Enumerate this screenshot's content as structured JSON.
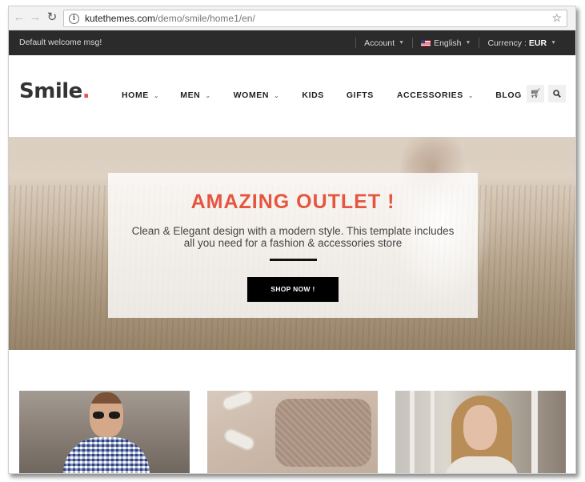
{
  "browser": {
    "url_domain": "kutethemes.com",
    "url_path": "/demo/smile/home1/en/",
    "back_icon": "arrow-left-icon",
    "forward_icon": "arrow-right-icon",
    "reload_icon": "reload-icon",
    "info_icon": "info-icon",
    "bookmark_icon": "star-icon"
  },
  "topbar": {
    "welcome": "Default welcome msg!",
    "account": "Account",
    "language": "English",
    "currency_label": "Currency :",
    "currency_value": "EUR"
  },
  "header": {
    "logo_text": "Smile",
    "logo_dot": ".",
    "menu": [
      {
        "label": "HOME",
        "has_dropdown": true
      },
      {
        "label": "MEN",
        "has_dropdown": true
      },
      {
        "label": "WOMEN",
        "has_dropdown": true
      },
      {
        "label": "KIDS",
        "has_dropdown": false
      },
      {
        "label": "GIFTS",
        "has_dropdown": false
      },
      {
        "label": "ACCESSORIES",
        "has_dropdown": true
      },
      {
        "label": "BLOG",
        "has_dropdown": false
      }
    ],
    "cart_icon": "cart-icon",
    "search_icon": "search-icon"
  },
  "hero": {
    "title": "AMAZING OUTLET !",
    "subtitle_line1": "Clean & Elegant design with a modern style. This template includes",
    "subtitle_line2": "all you need for a fashion & accessories store",
    "button": "SHOP NOW !"
  },
  "colors": {
    "accent": "#e5553f",
    "logo_dot": "#e8524b",
    "topbar_bg": "#2b2b2b"
  }
}
